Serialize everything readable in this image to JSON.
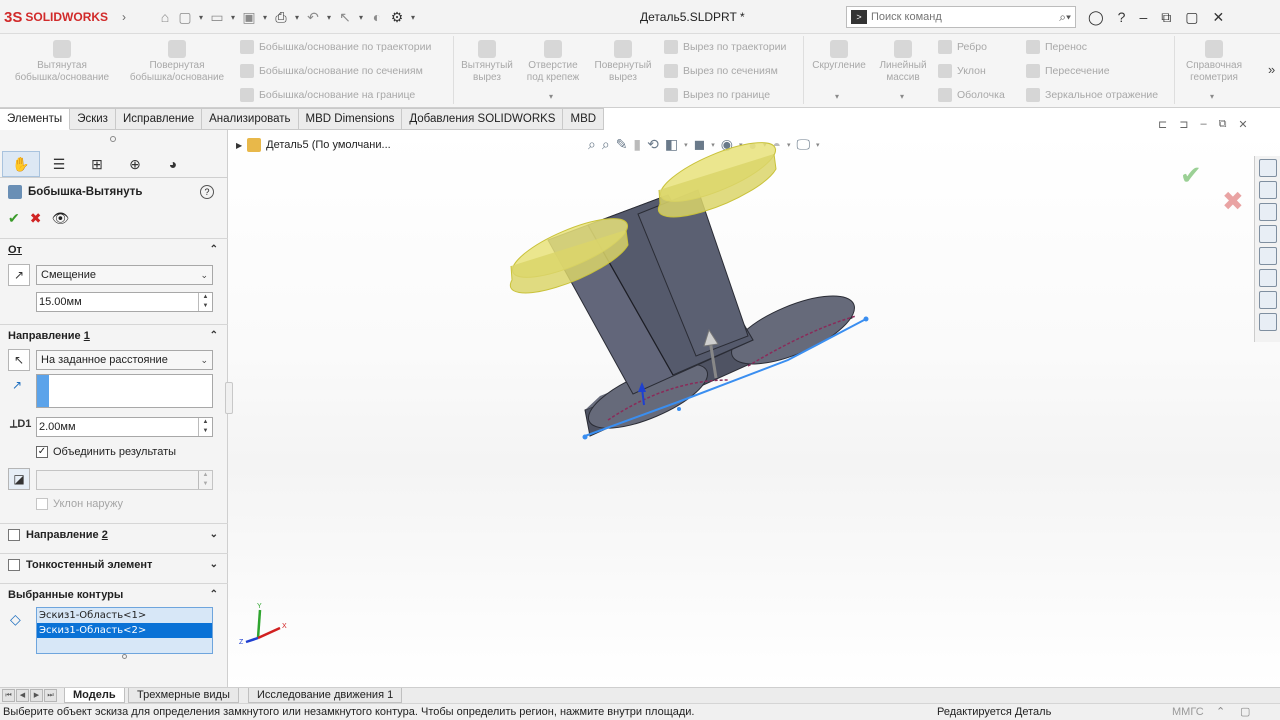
{
  "app": {
    "logo_text": "SOLIDWORKS",
    "logo_mark": "3S",
    "document_title": "Деталь5.SLDPRT *"
  },
  "search": {
    "placeholder": "Поиск команд"
  },
  "ribbon": {
    "big_buttons": [
      {
        "line1": "Вытянутая",
        "line2": "бобышка/основание"
      },
      {
        "line1": "Повернутая",
        "line2": "бобышка/основание"
      },
      {
        "line1": "Вытянутый",
        "line2": "вырез"
      },
      {
        "line1": "Отверстие",
        "line2": "под крепеж"
      },
      {
        "line1": "Повернутый",
        "line2": "вырез"
      },
      {
        "line1": "Скругление",
        "line2": ""
      },
      {
        "line1": "Линейный",
        "line2": "массив"
      },
      {
        "line1": "Справочная",
        "line2": "геометрия"
      }
    ],
    "boss_small": [
      "Бобышка/основание по траектории",
      "Бобышка/основание по сечениям",
      "Бобышка/основание на границе"
    ],
    "cut_small": [
      "Вырез по траектории",
      "Вырез по сечениям",
      "Вырез по границе"
    ],
    "features_small_a": [
      "Ребро",
      "Уклон",
      "Оболочка"
    ],
    "features_small_b": [
      "Перенос",
      "Пересечение",
      "Зеркальное отражение"
    ]
  },
  "tabs": [
    {
      "label": "Элементы",
      "active": true
    },
    {
      "label": "Эскиз"
    },
    {
      "label": "Исправление"
    },
    {
      "label": "Анализировать"
    },
    {
      "label": "MBD Dimensions"
    },
    {
      "label": "Добавления SOLIDWORKS"
    },
    {
      "label": "MBD"
    }
  ],
  "panel": {
    "feature_title": "Бобышка-Вытянуть",
    "from_section": {
      "title": "От",
      "start_condition": "Смещение",
      "offset_value": "15.00мм"
    },
    "direction1": {
      "title": "Направление",
      "title_num": "1",
      "end_condition": "На заданное расстояние",
      "depth_value": "2.00мм",
      "merge_label": "Объединить результаты",
      "merge_checked": true,
      "draft_label": "Уклон наружу"
    },
    "direction2": {
      "title": "Направление",
      "title_num": "2"
    },
    "thin_feature": {
      "title": "Тонкостенный элемент"
    },
    "selected_contours": {
      "title": "Выбранные контуры",
      "items": [
        "Эскиз1-Область<1>",
        "Эскиз1-Область<2>"
      ]
    }
  },
  "viewport": {
    "tree_label": "Деталь5  (По умолчани...",
    "triad_labels": {
      "x": "X",
      "y": "Y",
      "z": "Z"
    }
  },
  "bottom_tabs": [
    {
      "label": "Модель",
      "active": true
    },
    {
      "label": "Трехмерные виды"
    },
    {
      "label": "Исследование движения 1"
    }
  ],
  "status": {
    "message": "Выберите объект эскиза для определения замкнутого или незамкнутого контура. Чтобы определить регион, нажмите внутри площади.",
    "mode": "Редактируется Деталь",
    "units": "ММГС"
  },
  "colors": {
    "brand_red": "#d12a2a",
    "accept_green": "#3a9b2a",
    "cancel_red": "#d02424",
    "selection_blue": "#0a72d6",
    "model_gray": "#5e6272",
    "preview_yellow": "#e8e27a"
  }
}
